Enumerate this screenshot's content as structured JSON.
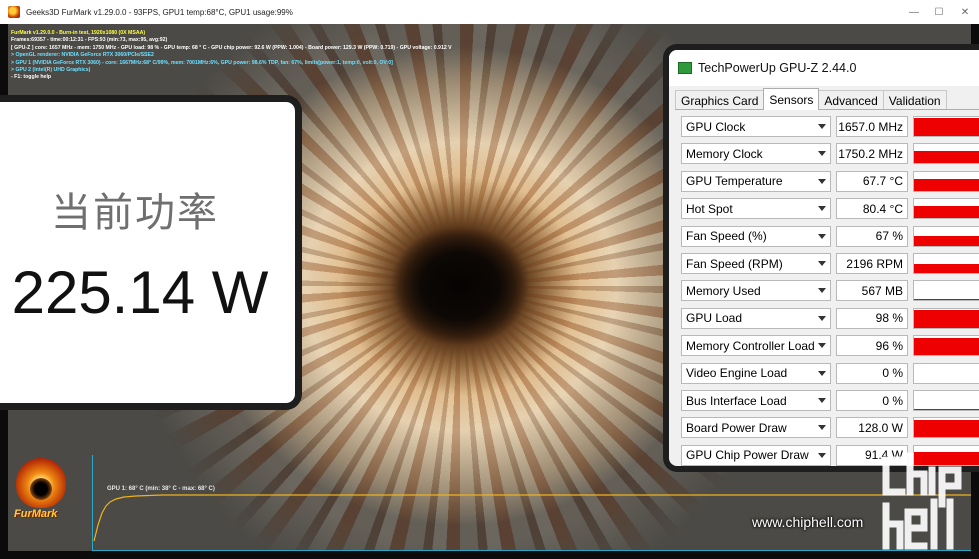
{
  "window": {
    "title": "Geeks3D FurMark v1.29.0.0 - 93FPS, GPU1 temp:68°C, GPU1 usage:99%",
    "minimize_glyph": "—",
    "maximize_glyph": "☐",
    "close_glyph": "✕"
  },
  "overlay": {
    "lines": [
      {
        "text": "FurMark v1.29.0.0 - Burn-in test, 1920x1080 (0X MSAA)",
        "color": "#ffff44"
      },
      {
        "text": "Frames:69357 - time:00:12:31 - FPS:93 (min:73, max:95, avg:92)",
        "color": "#ffffff"
      },
      {
        "text": "[ GPU-Z ] core: 1657 MHz - mem: 1750 MHz - GPU load: 98 % - GPU temp: 68 ° C - GPU chip power: 92.6 W (PPW: 1.004) - Board power: 129.3 W (PPW: 0.719) - GPU voltage: 0.912 V",
        "color": "#ffffff"
      },
      {
        "text": "> OpenGL renderer: NVIDIA GeForce RTX 3060/PCIe/SSE2",
        "color": "#6ee0ff"
      },
      {
        "text": "> GPU 1 (NVIDIA GeForce RTX 3060) - core: 1667MHz:68° C/99%, mem: 7001MHz:6%, GPU power: 98.6% TDP, fan: 67%, limits[power:1, temp:0, volt:0, OV:0]",
        "color": "#6ee0ff"
      },
      {
        "text": "> GPU 2 (Intel(R) UHD Graphics)",
        "color": "#6ee0ff"
      },
      {
        "text": "- F1: toggle help",
        "color": "#ffffff"
      }
    ]
  },
  "power_panel": {
    "label": "当前功率",
    "value": "225.14 W"
  },
  "graph": {
    "label": "GPU 1: 68° C (min: 38° C - max: 68° C)"
  },
  "furmark_logo": {
    "text": "FurMark"
  },
  "gpuz": {
    "title": "TechPowerUp GPU-Z 2.44.0",
    "tabs": [
      "Graphics Card",
      "Sensors",
      "Advanced",
      "Validation"
    ],
    "active_tab": "Sensors",
    "sensors": [
      {
        "name": "GPU Clock",
        "value": "1657.0 MHz",
        "level": 0.95
      },
      {
        "name": "Memory Clock",
        "value": "1750.2 MHz",
        "level": 0.65
      },
      {
        "name": "GPU Temperature",
        "value": "67.7 °C",
        "level": 0.6
      },
      {
        "name": "Hot Spot",
        "value": "80.4 °C",
        "level": 0.65
      },
      {
        "name": "Fan Speed (%)",
        "value": "67 %",
        "level": 0.5
      },
      {
        "name": "Fan Speed (RPM)",
        "value": "2196 RPM",
        "level": 0.5
      },
      {
        "name": "Memory Used",
        "value": "567 MB",
        "level": 0.05
      },
      {
        "name": "GPU Load",
        "value": "98 %",
        "level": 0.95
      },
      {
        "name": "Memory Controller Load",
        "value": "96 %",
        "level": 0.92
      },
      {
        "name": "Video Engine Load",
        "value": "0 %",
        "level": 0
      },
      {
        "name": "Bus Interface Load",
        "value": "0 %",
        "level": 0.03
      },
      {
        "name": "Board Power Draw",
        "value": "128.0 W",
        "level": 0.9
      },
      {
        "name": "GPU Chip Power Draw",
        "value": "91.4 W",
        "level": 0.7
      }
    ]
  },
  "watermark": {
    "url": "www.chiphell.com",
    "logo_text": "chip hell"
  }
}
